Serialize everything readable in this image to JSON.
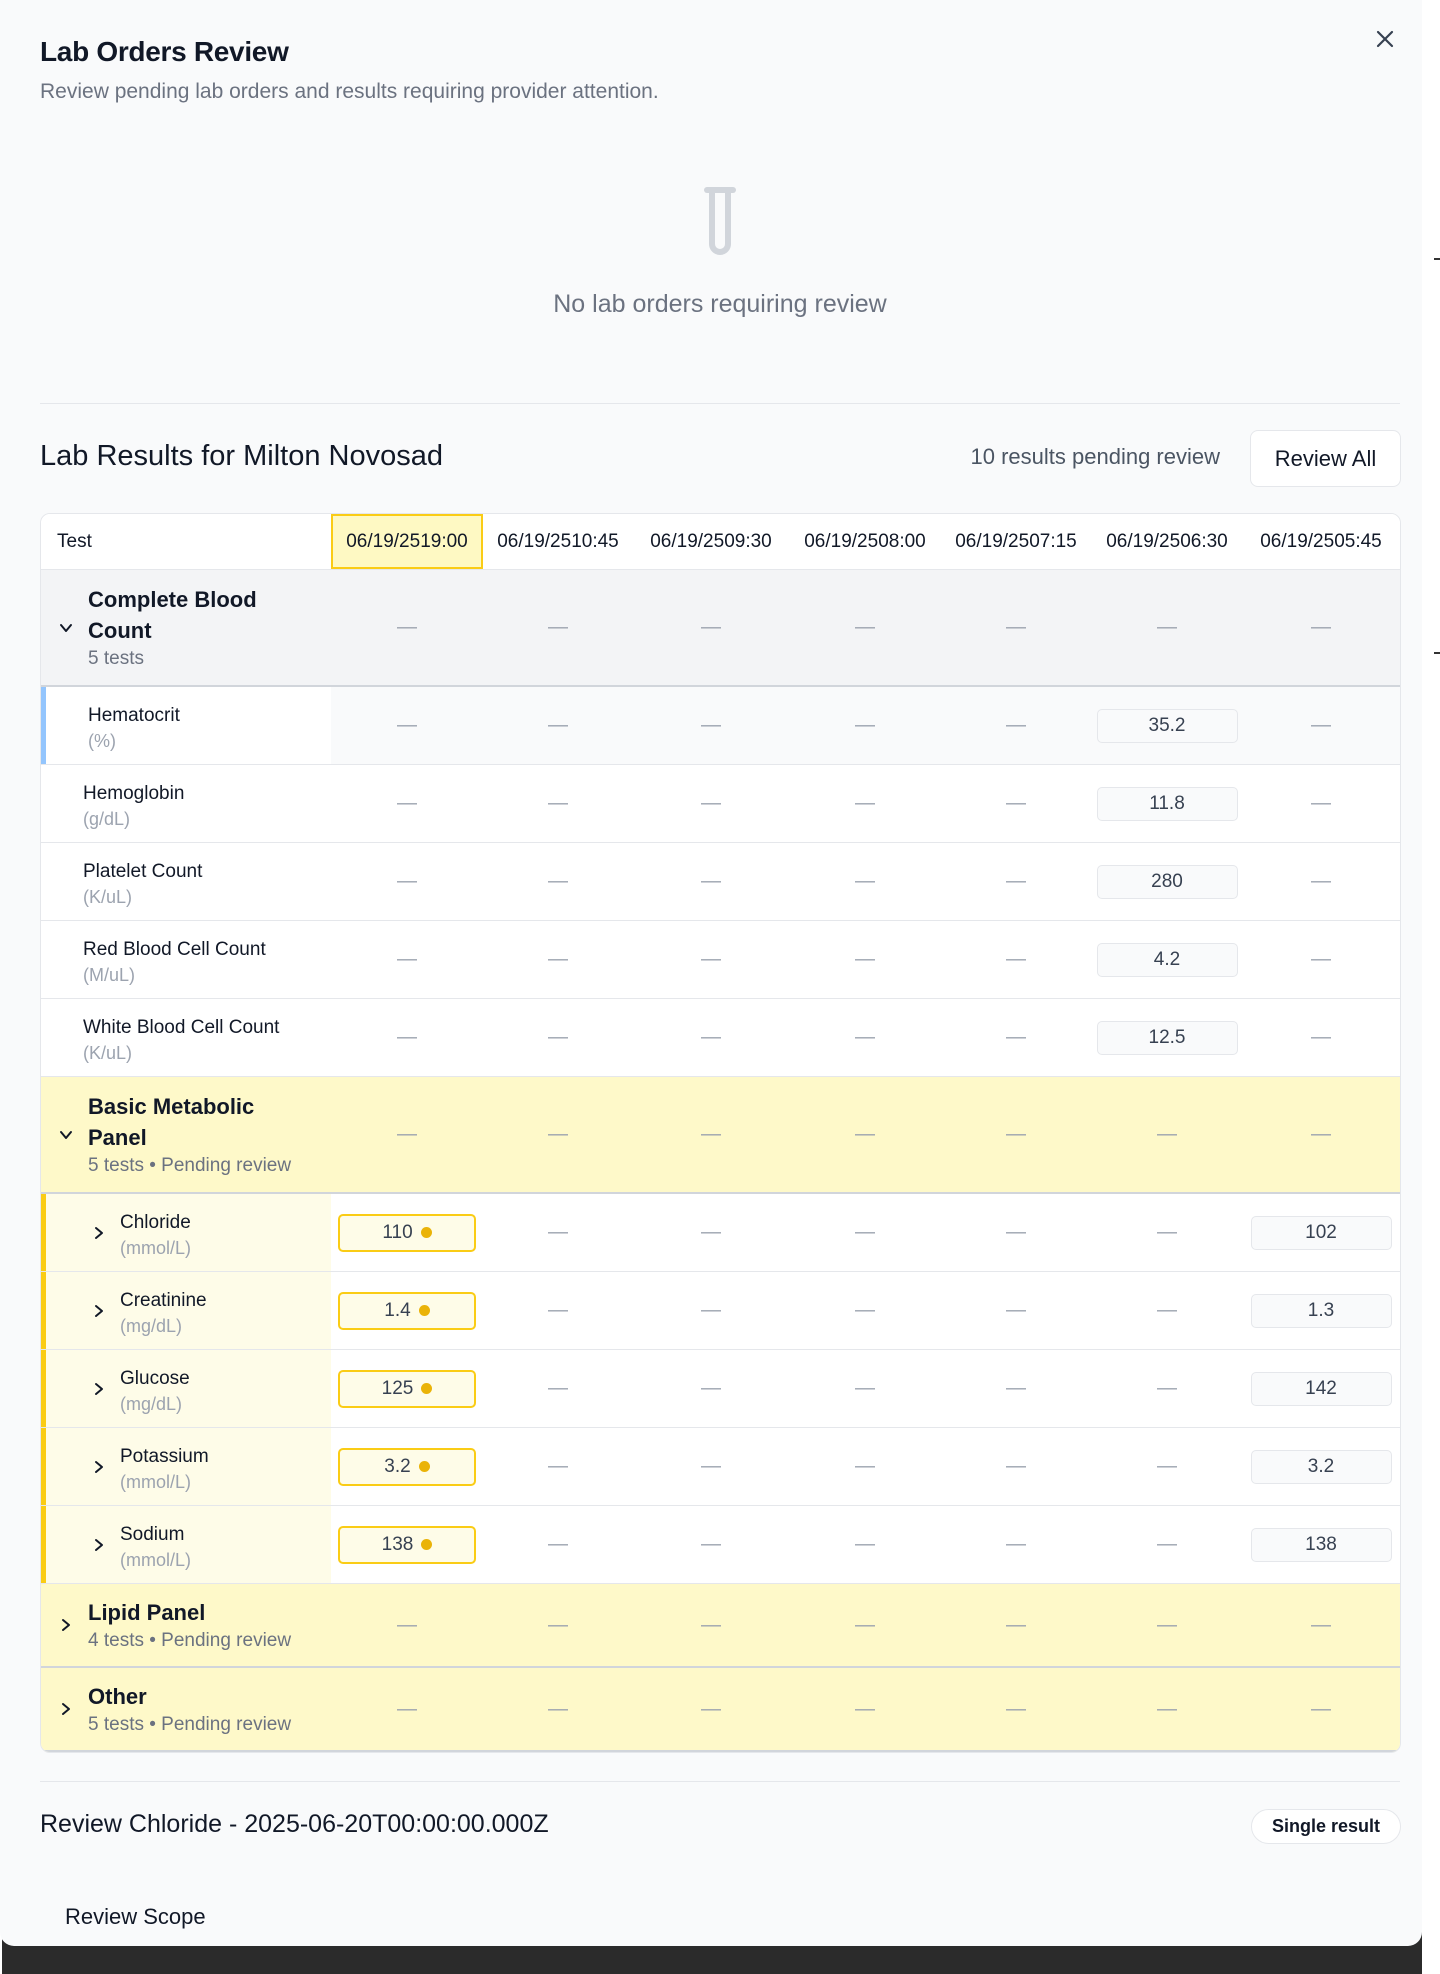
{
  "modal": {
    "title": "Lab Orders Review",
    "subtitle": "Review pending lab orders and results requiring provider attention."
  },
  "empty_state": {
    "icon": "test-tube-icon",
    "message": "No lab orders requiring review"
  },
  "results": {
    "title": "Lab Results for Milton Novosad",
    "pending_count": "10 results pending review",
    "review_all_label": "Review All"
  },
  "table": {
    "test_header": "Test",
    "columns": [
      "06/19/2519:00",
      "06/19/2510:45",
      "06/19/2509:30",
      "06/19/2508:00",
      "06/19/2507:15",
      "06/19/2506:30",
      "06/19/2505:45"
    ],
    "highlighted_column": 0,
    "empty_value": "—",
    "groups": [
      {
        "name": "Complete Blood Count",
        "subtitle": "5 tests",
        "expanded": true,
        "style": "gray",
        "tests": [
          {
            "name": "Hematocrit",
            "unit": "(%)",
            "values": [
              "",
              "",
              "",
              "",
              "",
              "35.2",
              ""
            ]
          },
          {
            "name": "Hemoglobin",
            "unit": "(g/dL)",
            "values": [
              "",
              "",
              "",
              "",
              "",
              "11.8",
              ""
            ]
          },
          {
            "name": "Platelet Count",
            "unit": "(K/uL)",
            "values": [
              "",
              "",
              "",
              "",
              "",
              "280",
              ""
            ]
          },
          {
            "name": "Red Blood Cell Count",
            "unit": "(M/uL)",
            "values": [
              "",
              "",
              "",
              "",
              "",
              "4.2",
              ""
            ]
          },
          {
            "name": "White Blood Cell Count",
            "unit": "(K/uL)",
            "values": [
              "",
              "",
              "",
              "",
              "",
              "12.5",
              ""
            ]
          }
        ]
      },
      {
        "name": "Basic Metabolic Panel",
        "subtitle": "5 tests • Pending review",
        "expanded": true,
        "style": "yellow",
        "tests": [
          {
            "name": "Chloride",
            "unit": "(mmol/L)",
            "values": [
              "110",
              "",
              "",
              "",
              "",
              "",
              "102"
            ],
            "pending": [
              true,
              false,
              false,
              false,
              false,
              false,
              false
            ]
          },
          {
            "name": "Creatinine",
            "unit": "(mg/dL)",
            "values": [
              "1.4",
              "",
              "",
              "",
              "",
              "",
              "1.3"
            ],
            "pending": [
              true,
              false,
              false,
              false,
              false,
              false,
              false
            ]
          },
          {
            "name": "Glucose",
            "unit": "(mg/dL)",
            "values": [
              "125",
              "",
              "",
              "",
              "",
              "",
              "142"
            ],
            "pending": [
              true,
              false,
              false,
              false,
              false,
              false,
              false
            ]
          },
          {
            "name": "Potassium",
            "unit": "(mmol/L)",
            "values": [
              "3.2",
              "",
              "",
              "",
              "",
              "",
              "3.2"
            ],
            "pending": [
              true,
              false,
              false,
              false,
              false,
              false,
              false
            ]
          },
          {
            "name": "Sodium",
            "unit": "(mmol/L)",
            "values": [
              "138",
              "",
              "",
              "",
              "",
              "",
              "138"
            ],
            "pending": [
              true,
              false,
              false,
              false,
              false,
              false,
              false
            ]
          }
        ]
      },
      {
        "name": "Lipid Panel",
        "subtitle": "4 tests • Pending review",
        "expanded": false,
        "style": "yellow",
        "tests": []
      },
      {
        "name": "Other",
        "subtitle": "5 tests • Pending review",
        "expanded": false,
        "style": "yellow",
        "tests": []
      }
    ]
  },
  "review_panel": {
    "title": "Review Chloride - 2025-06-20T00:00:00.000Z",
    "badge": "Single result",
    "scope_label": "Review Scope"
  },
  "colors": {
    "pending_yellow": "#facc15",
    "pending_bg": "#fef9c9",
    "cbc_accent": "#93c5fd",
    "group_gray": "#f3f4f6"
  }
}
